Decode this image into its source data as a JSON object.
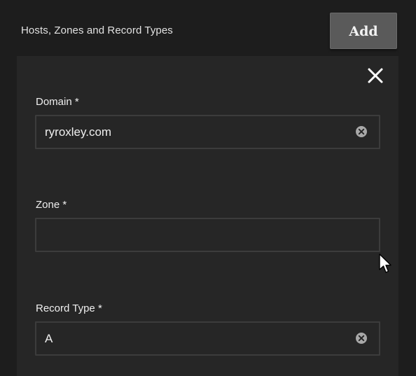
{
  "header": {
    "title": "Hosts, Zones and Record Types",
    "add_label": "Add"
  },
  "form": {
    "domain": {
      "label": "Domain *",
      "value": "ryroxley.com"
    },
    "zone": {
      "label": "Zone *",
      "value": ""
    },
    "record_type": {
      "label": "Record Type *",
      "value": "A"
    }
  },
  "icons": {
    "close": "close-icon",
    "clear": "clear-circle-icon",
    "cursor": "mouse-pointer-icon"
  },
  "colors": {
    "background": "#1d1d1d",
    "panel": "#262626",
    "button": "#5a5a5a",
    "field_border": "#3c3c3c",
    "text": "#efefef"
  }
}
